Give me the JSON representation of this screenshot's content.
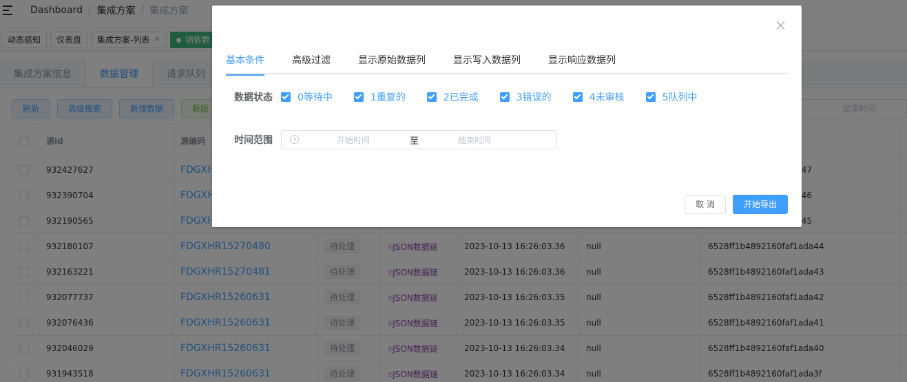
{
  "breadcrumb": [
    "Dashboard",
    "集成方案",
    "集成方案"
  ],
  "tags": [
    {
      "label": "动态感知"
    },
    {
      "label": "仪表盘"
    },
    {
      "label": "集成方案-列表"
    },
    {
      "label": "销售数"
    }
  ],
  "subtabs": [
    "集成方案信息",
    "数据管理",
    "请求队列"
  ],
  "buttons": {
    "refresh": "刷新",
    "advanced_search": "高级搜索",
    "add_data": "新增数据",
    "new_version": "新版"
  },
  "filter": {
    "end_placeholder": "结束时间"
  },
  "table": {
    "headers": [
      "源id",
      "源编码"
    ],
    "rows": [
      {
        "id": "932427627",
        "code": "FDGXHR",
        "status": "",
        "type": "",
        "time": "",
        "val": "",
        "hash": "47"
      },
      {
        "id": "932390704",
        "code": "FDGXHR",
        "status": "",
        "type": "",
        "time": "",
        "val": "",
        "hash": "46"
      },
      {
        "id": "932190565",
        "code": "FDGXHR",
        "status": "",
        "type": "",
        "time": "",
        "val": "",
        "hash": "45"
      },
      {
        "id": "932180107",
        "code": "FDGXHR15270480",
        "status": "待处理",
        "type": "JSON数据链",
        "time": "2023-10-13 16:26:03.36",
        "val": "null",
        "hash": "6528ff1b4892160faf1ada44"
      },
      {
        "id": "932163221",
        "code": "FDGXHR15270481",
        "status": "待处理",
        "type": "JSON数据链",
        "time": "2023-10-13 16:26:03.36",
        "val": "null",
        "hash": "6528ff1b4892160faf1ada43"
      },
      {
        "id": "932077737",
        "code": "FDGXHR15260631",
        "status": "待处理",
        "type": "JSON数据链",
        "time": "2023-10-13 16:26:03.35",
        "val": "null",
        "hash": "6528ff1b4892160faf1ada42"
      },
      {
        "id": "932076436",
        "code": "FDGXHR15260631",
        "status": "待处理",
        "type": "JSON数据链",
        "time": "2023-10-13 16:26:03.35",
        "val": "null",
        "hash": "6528ff1b4892160faf1ada41"
      },
      {
        "id": "932046029",
        "code": "FDGXHR15260631",
        "status": "待处理",
        "type": "JSON数据链",
        "time": "2023-10-13 16:26:03.34",
        "val": "null",
        "hash": "6528ff1b4892160faf1ada40"
      },
      {
        "id": "931943518",
        "code": "FDGXHR15260631",
        "status": "待处理",
        "type": "JSON数据链",
        "time": "2023-10-13 16:26:03.34",
        "val": "null",
        "hash": "6528ff1b4892160faf1ada3f"
      }
    ]
  },
  "dialog": {
    "tabs": [
      "基本条件",
      "高级过滤",
      "显示原始数据列",
      "显示写入数据列",
      "显示响应数据列"
    ],
    "status_label": "数据状态",
    "status_options": [
      "0等待中",
      "1重复的",
      "2已完成",
      "3错误的",
      "4未审核",
      "5队列中"
    ],
    "range_label": "时间范围",
    "range_start": "开始时间",
    "range_sep": "至",
    "range_end": "结束时间",
    "cancel": "取 消",
    "export": "开始导出"
  },
  "colors": {
    "primary": "#409eff",
    "mask": "rgba(0,0,0,0.5)",
    "tag_active": "#42b983"
  }
}
